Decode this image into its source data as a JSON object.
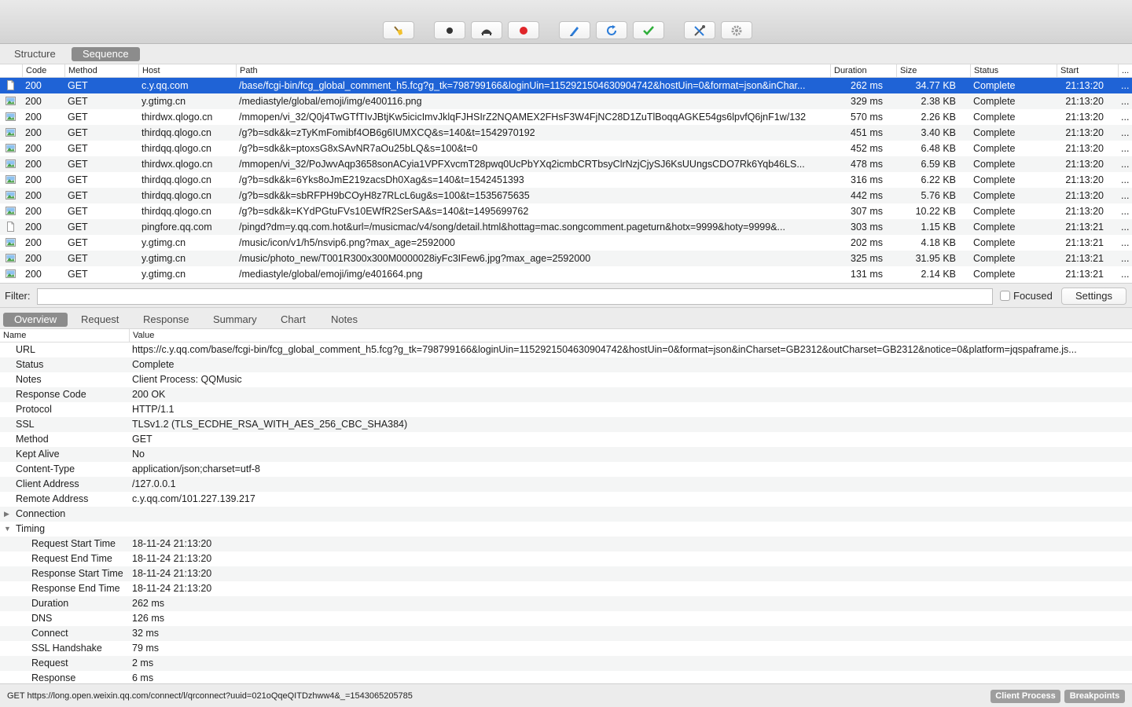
{
  "toolbar": {
    "buttons": [
      "broom-icon",
      "record-icon",
      "throttle-icon",
      "breakpoint-icon",
      "compose-icon",
      "repeat-icon",
      "validate-icon",
      "tools-icon",
      "settings-icon"
    ]
  },
  "view_tabs": {
    "structure": "Structure",
    "sequence": "Sequence"
  },
  "columns": {
    "code": "Code",
    "method": "Method",
    "host": "Host",
    "path": "Path",
    "duration": "Duration",
    "size": "Size",
    "status": "Status",
    "start": "Start",
    "more": "..."
  },
  "requests": [
    {
      "icon": "document-icon",
      "code": "200",
      "method": "GET",
      "host": "c.y.qq.com",
      "path": "/base/fcgi-bin/fcg_global_comment_h5.fcg?g_tk=798799166&loginUin=1152921504630904742&hostUin=0&format=json&inChar...",
      "duration": "262 ms",
      "size": "34.77 KB",
      "status": "Complete",
      "start": "21:13:20",
      "more": "..."
    },
    {
      "icon": "image-icon",
      "code": "200",
      "method": "GET",
      "host": "y.gtimg.cn",
      "path": "/mediastyle/global/emoji/img/e400116.png",
      "duration": "329 ms",
      "size": "2.38 KB",
      "status": "Complete",
      "start": "21:13:20",
      "more": "..."
    },
    {
      "icon": "image-icon",
      "code": "200",
      "method": "GET",
      "host": "thirdwx.qlogo.cn",
      "path": "/mmopen/vi_32/Q0j4TwGTfTIvJBtjKw5icicImvJklqFJHSIrZ2NQAMEX2FHsF3W4FjNC28D1ZuTlBoqqAGKE54gs6lpvfQ6jnF1w/132",
      "duration": "570 ms",
      "size": "2.26 KB",
      "status": "Complete",
      "start": "21:13:20",
      "more": "..."
    },
    {
      "icon": "image-icon",
      "code": "200",
      "method": "GET",
      "host": "thirdqq.qlogo.cn",
      "path": "/g?b=sdk&k=zTyKmFomibf4OB6g6IUMXCQ&s=140&t=1542970192",
      "duration": "451 ms",
      "size": "3.40 KB",
      "status": "Complete",
      "start": "21:13:20",
      "more": "..."
    },
    {
      "icon": "image-icon",
      "code": "200",
      "method": "GET",
      "host": "thirdqq.qlogo.cn",
      "path": "/g?b=sdk&k=ptoxsG8xSAvNR7aOu25bLQ&s=100&t=0",
      "duration": "452 ms",
      "size": "6.48 KB",
      "status": "Complete",
      "start": "21:13:20",
      "more": "..."
    },
    {
      "icon": "image-icon",
      "code": "200",
      "method": "GET",
      "host": "thirdwx.qlogo.cn",
      "path": "/mmopen/vi_32/PoJwvAqp3658sonACyia1VPFXvcmT28pwq0UcPbYXq2icmbCRTbsyClrNzjCjySJ6KsUUngsCDO7Rk6Yqb46LS...",
      "duration": "478 ms",
      "size": "6.59 KB",
      "status": "Complete",
      "start": "21:13:20",
      "more": "..."
    },
    {
      "icon": "image-icon",
      "code": "200",
      "method": "GET",
      "host": "thirdqq.qlogo.cn",
      "path": "/g?b=sdk&k=6Yks8oJmE219zacsDh0Xag&s=140&t=1542451393",
      "duration": "316 ms",
      "size": "6.22 KB",
      "status": "Complete",
      "start": "21:13:20",
      "more": "..."
    },
    {
      "icon": "image-icon",
      "code": "200",
      "method": "GET",
      "host": "thirdqq.qlogo.cn",
      "path": "/g?b=sdk&k=sbRFPH9bCOyH8z7RLcL6ug&s=100&t=1535675635",
      "duration": "442 ms",
      "size": "5.76 KB",
      "status": "Complete",
      "start": "21:13:20",
      "more": "..."
    },
    {
      "icon": "image-icon",
      "code": "200",
      "method": "GET",
      "host": "thirdqq.qlogo.cn",
      "path": "/g?b=sdk&k=KYdPGtuFVs10EWfR2SerSA&s=140&t=1495699762",
      "duration": "307 ms",
      "size": "10.22 KB",
      "status": "Complete",
      "start": "21:13:20",
      "more": "..."
    },
    {
      "icon": "document-icon",
      "code": "200",
      "method": "GET",
      "host": "pingfore.qq.com",
      "path": "/pingd?dm=y.qq.com.hot&url=/musicmac/v4/song/detail.html&hottag=mac.songcomment.pageturn&hotx=9999&hoty=9999&...",
      "duration": "303 ms",
      "size": "1.15 KB",
      "status": "Complete",
      "start": "21:13:21",
      "more": "..."
    },
    {
      "icon": "image-icon",
      "code": "200",
      "method": "GET",
      "host": "y.gtimg.cn",
      "path": "/music/icon/v1/h5/nsvip6.png?max_age=2592000",
      "duration": "202 ms",
      "size": "4.18 KB",
      "status": "Complete",
      "start": "21:13:21",
      "more": "..."
    },
    {
      "icon": "image-icon",
      "code": "200",
      "method": "GET",
      "host": "y.gtimg.cn",
      "path": "/music/photo_new/T001R300x300M0000028iyFc3IFew6.jpg?max_age=2592000",
      "duration": "325 ms",
      "size": "31.95 KB",
      "status": "Complete",
      "start": "21:13:21",
      "more": "..."
    },
    {
      "icon": "image-icon",
      "code": "200",
      "method": "GET",
      "host": "y.gtimg.cn",
      "path": "/mediastyle/global/emoji/img/e401664.png",
      "duration": "131 ms",
      "size": "2.14 KB",
      "status": "Complete",
      "start": "21:13:21",
      "more": "..."
    }
  ],
  "filter": {
    "label": "Filter:",
    "value": "",
    "focused_label": "Focused",
    "settings_label": "Settings"
  },
  "detail_tabs": {
    "overview": "Overview",
    "request": "Request",
    "response": "Response",
    "summary": "Summary",
    "chart": "Chart",
    "notes": "Notes"
  },
  "detail_columns": {
    "name": "Name",
    "value": "Value"
  },
  "overview": {
    "url": {
      "name": "URL",
      "value": "https://c.y.qq.com/base/fcgi-bin/fcg_global_comment_h5.fcg?g_tk=798799166&loginUin=1152921504630904742&hostUin=0&format=json&inCharset=GB2312&outCharset=GB2312&notice=0&platform=jqspaframe.js..."
    },
    "status": {
      "name": "Status",
      "value": "Complete"
    },
    "notes": {
      "name": "Notes",
      "value": "Client Process: QQMusic"
    },
    "response_code": {
      "name": "Response Code",
      "value": "200 OK"
    },
    "protocol": {
      "name": "Protocol",
      "value": "HTTP/1.1"
    },
    "ssl": {
      "name": "SSL",
      "value": "TLSv1.2 (TLS_ECDHE_RSA_WITH_AES_256_CBC_SHA384)"
    },
    "method": {
      "name": "Method",
      "value": "GET"
    },
    "kept_alive": {
      "name": "Kept Alive",
      "value": "No"
    },
    "content_type": {
      "name": "Content-Type",
      "value": "application/json;charset=utf-8"
    },
    "client_address": {
      "name": "Client Address",
      "value": "/127.0.0.1"
    },
    "remote_address": {
      "name": "Remote Address",
      "value": "c.y.qq.com/101.227.139.217"
    },
    "connection": {
      "name": "Connection",
      "value": ""
    },
    "timing": {
      "name": "Timing",
      "value": ""
    },
    "request_start_time": {
      "name": "Request Start Time",
      "value": "18-11-24 21:13:20"
    },
    "request_end_time": {
      "name": "Request End Time",
      "value": "18-11-24 21:13:20"
    },
    "response_start_time": {
      "name": "Response Start Time",
      "value": "18-11-24 21:13:20"
    },
    "response_end_time": {
      "name": "Response End Time",
      "value": "18-11-24 21:13:20"
    },
    "duration": {
      "name": "Duration",
      "value": "262 ms"
    },
    "dns": {
      "name": "DNS",
      "value": "126 ms"
    },
    "connect": {
      "name": "Connect",
      "value": "32 ms"
    },
    "ssl_handshake": {
      "name": "SSL Handshake",
      "value": "79 ms"
    },
    "request": {
      "name": "Request",
      "value": "2 ms"
    },
    "response": {
      "name": "Response",
      "value": "6 ms"
    }
  },
  "statusbar": {
    "text": "GET https://long.open.weixin.qq.com/connect/l/qrconnect?uuid=021oQqeQITDzhww4&_=1543065205785",
    "client_process_label": "Client Process",
    "breakpoints_label": "Breakpoints"
  },
  "colors": {
    "selection": "#1f63d6",
    "tab_active": "#8c8c8c",
    "record_red": "#e0262a",
    "check_green": "#2fae3a"
  }
}
